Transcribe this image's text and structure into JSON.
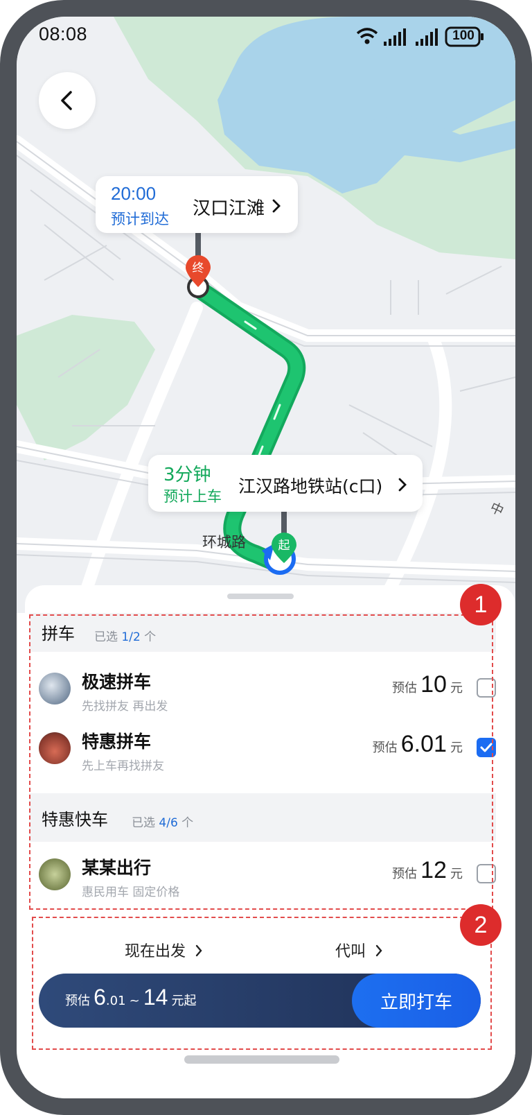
{
  "status_bar": {
    "time": "08:08",
    "battery": "100"
  },
  "map": {
    "destination": {
      "time": "20:00",
      "label": "预计到达",
      "place": "汉口江滩",
      "marker": "终"
    },
    "pickup": {
      "time": "3分钟",
      "label": "预计上车",
      "place": "江汉路地铁站(c口)",
      "marker": "起"
    },
    "road_labels": [
      "环城路",
      "中"
    ]
  },
  "sections": [
    {
      "title": "拼车",
      "selected_prefix": "已选",
      "selected_count": "1/2",
      "selected_suffix": "个",
      "items": [
        {
          "name": "极速拼车",
          "desc": "先找拼友 再出发",
          "price_prefix": "预估",
          "price": "10",
          "unit": "元",
          "checked": false
        },
        {
          "name": "特惠拼车",
          "desc": "先上车再找拼友",
          "price_prefix": "预估",
          "price": "6.01",
          "unit": "元",
          "checked": true
        }
      ]
    },
    {
      "title": "特惠快车",
      "selected_prefix": "已选",
      "selected_count": "4/6",
      "selected_suffix": "个",
      "items": [
        {
          "name": "某某出行",
          "desc": "惠民用车 固定价格",
          "price_prefix": "预估",
          "price": "12",
          "unit": "元",
          "checked": false
        }
      ]
    }
  ],
  "options": {
    "depart": "现在出发",
    "proxy": "代叫"
  },
  "footer": {
    "est_prefix": "预估",
    "price_low_int": "6",
    "price_low_dec": ".01",
    "tilde": "~",
    "price_high": "14",
    "suffix": "元起",
    "call_button": "立即打车"
  },
  "annotations": {
    "badge1": "1",
    "badge2": "2"
  },
  "colors": {
    "accent": "#1b6cf2",
    "route": "#19b865",
    "annotation": "#dd2c2c",
    "dest_marker": "#e8492c"
  }
}
